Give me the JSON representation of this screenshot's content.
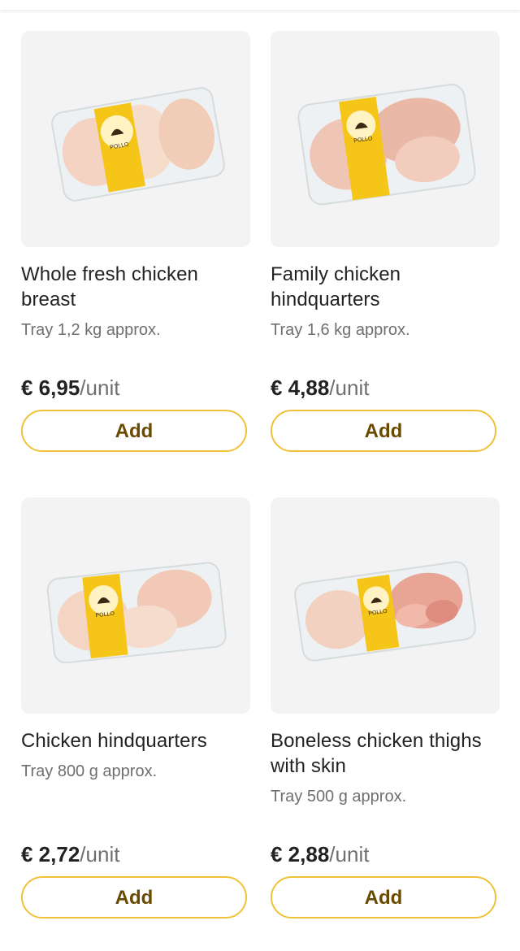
{
  "products": [
    {
      "name": "Whole fresh chicken breast",
      "size": "Tray 1,2 kg approx.",
      "price": "€ 6,95",
      "unit": "/unit",
      "button": "Add",
      "label_text": "POLLO"
    },
    {
      "name": "Family chicken hindquarters",
      "size": "Tray 1,6 kg approx.",
      "price": "€ 4,88",
      "unit": "/unit",
      "button": "Add",
      "label_text": "POLLO"
    },
    {
      "name": "Chicken hindquarters",
      "size": "Tray 800 g approx.",
      "price": "€ 2,72",
      "unit": "/unit",
      "button": "Add",
      "label_text": "POLLO"
    },
    {
      "name": "Boneless chicken thighs with skin",
      "size": "Tray 500 g approx.",
      "price": "€ 2,88",
      "unit": "/unit",
      "button": "Add",
      "label_text": "POLLO"
    }
  ],
  "colors": {
    "accent": "#f0c23a",
    "button_text": "#6a4a00",
    "muted_text": "#6f6f6f",
    "thumb_bg": "#f3f3f3",
    "label_yellow": "#f5c518"
  }
}
